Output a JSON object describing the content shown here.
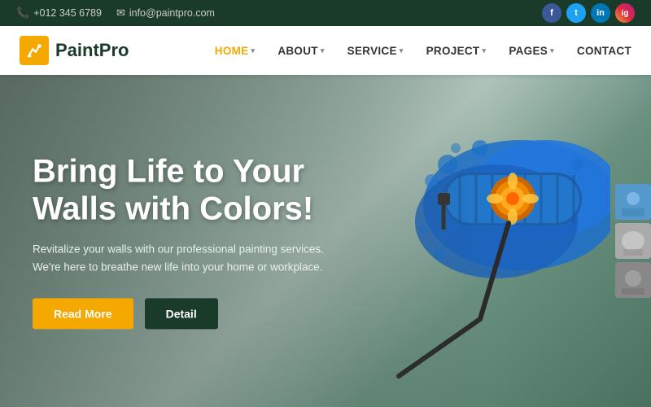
{
  "topbar": {
    "phone": "+012 345 6789",
    "email": "info@paintpro.com",
    "social": {
      "facebook": "f",
      "twitter": "t",
      "linkedin": "in",
      "instagram": "ig"
    }
  },
  "navbar": {
    "brand": "PaintPro",
    "links": [
      {
        "label": "HOME",
        "active": true,
        "hasDropdown": true
      },
      {
        "label": "ABOUT",
        "active": false,
        "hasDropdown": true
      },
      {
        "label": "SERVICE",
        "active": false,
        "hasDropdown": true
      },
      {
        "label": "PROJECT",
        "active": false,
        "hasDropdown": true
      },
      {
        "label": "PAGES",
        "active": false,
        "hasDropdown": true
      },
      {
        "label": "CONTACT",
        "active": false,
        "hasDropdown": false
      }
    ]
  },
  "hero": {
    "title": "Bring Life to Your Walls with Colors!",
    "subtitle": "Revitalize your walls with our professional painting services. We're here to breathe new life into your home or workplace.",
    "cta_primary": "Read More",
    "cta_secondary": "Detail"
  },
  "colors": {
    "dark_green": "#1a3a2a",
    "gold": "#f5a800",
    "white": "#ffffff"
  }
}
